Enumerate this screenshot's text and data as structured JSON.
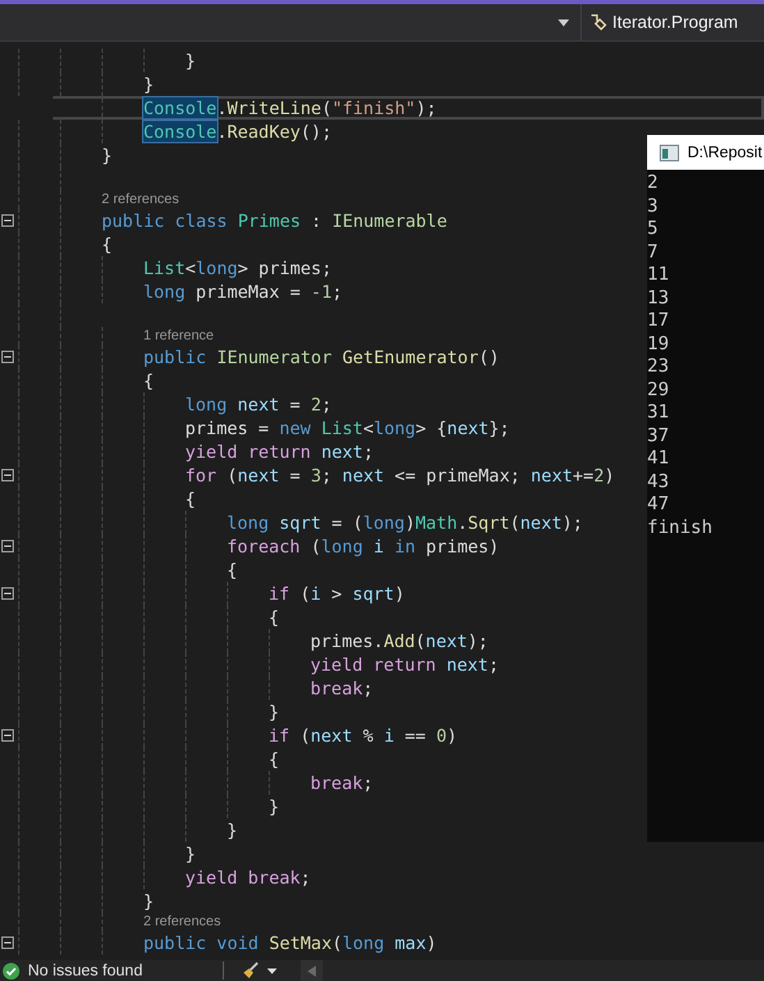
{
  "navigation_bar": {
    "member_dropdown": "Iterator.Program"
  },
  "lines": [
    {
      "kind": "group",
      "children": [
        {
          "kind": "group",
          "children": [
            {
              "kind": "code",
              "fold": false,
              "current": false,
              "tokens": [
                {
                  "text": "}",
                  "kind": "plain"
                }
              ]
            }
          ]
        },
        {
          "kind": "code",
          "fold": false,
          "current": false,
          "tokens": [
            {
              "text": "}",
              "kind": "plain"
            }
          ]
        },
        {
          "kind": "code",
          "fold": false,
          "current": true,
          "tokens": [
            {
              "text": "Console",
              "kind": "type",
              "highlighted": true
            },
            {
              "text": ".",
              "kind": "plain"
            },
            {
              "text": "WriteLine",
              "kind": "method"
            },
            {
              "text": "(",
              "kind": "plain"
            },
            {
              "text": "\"finish\"",
              "kind": "string"
            },
            {
              "text": ");",
              "kind": "plain"
            }
          ]
        },
        {
          "kind": "code",
          "fold": false,
          "current": false,
          "tokens": [
            {
              "text": "Console",
              "kind": "type",
              "highlighted": true
            },
            {
              "text": ".",
              "kind": "plain"
            },
            {
              "text": "ReadKey",
              "kind": "method"
            },
            {
              "text": "();",
              "kind": "plain"
            }
          ]
        }
      ]
    },
    {
      "kind": "code",
      "fold": false,
      "current": false,
      "tokens": [
        {
          "text": "}",
          "kind": "plain"
        }
      ]
    },
    {
      "kind": "blank"
    },
    {
      "kind": "codelens",
      "text": "2 references"
    },
    {
      "kind": "code",
      "fold": true,
      "current": false,
      "tokens": [
        {
          "text": "public class ",
          "kind": "keyword"
        },
        {
          "text": "Primes",
          "kind": "type"
        },
        {
          "text": " : ",
          "kind": "plain"
        },
        {
          "text": "IEnumerable",
          "kind": "interface"
        }
      ]
    },
    {
      "kind": "code",
      "fold": false,
      "current": false,
      "tokens": [
        {
          "text": "{",
          "kind": "plain"
        }
      ],
      "children": [
        {
          "kind": "code",
          "fold": false,
          "current": false,
          "tokens": [
            {
              "text": "List",
              "kind": "type"
            },
            {
              "text": "<",
              "kind": "plain"
            },
            {
              "text": "long",
              "kind": "keyword"
            },
            {
              "text": "> primes;",
              "kind": "plain"
            }
          ]
        },
        {
          "kind": "code",
          "fold": false,
          "current": false,
          "tokens": [
            {
              "text": "long",
              "kind": "keyword"
            },
            {
              "text": " primeMax = ",
              "kind": "plain"
            },
            {
              "text": "-1",
              "kind": "number"
            },
            {
              "text": ";",
              "kind": "plain"
            }
          ]
        },
        {
          "kind": "blank"
        },
        {
          "kind": "codelens",
          "text": "1 reference"
        },
        {
          "kind": "code",
          "fold": true,
          "current": false,
          "tokens": [
            {
              "text": "public ",
              "kind": "keyword"
            },
            {
              "text": "IEnumerator",
              "kind": "interface"
            },
            {
              "text": " GetEnumerator",
              "kind": "method"
            },
            {
              "text": "()",
              "kind": "plain"
            }
          ]
        },
        {
          "kind": "code",
          "fold": false,
          "current": false,
          "tokens": [
            {
              "text": "{",
              "kind": "plain"
            }
          ],
          "children": [
            {
              "kind": "code",
              "fold": false,
              "current": false,
              "tokens": [
                {
                  "text": "long ",
                  "kind": "keyword"
                },
                {
                  "text": "next",
                  "kind": "local"
                },
                {
                  "text": " = ",
                  "kind": "plain"
                },
                {
                  "text": "2",
                  "kind": "number"
                },
                {
                  "text": ";",
                  "kind": "plain"
                }
              ]
            },
            {
              "kind": "code",
              "fold": false,
              "current": false,
              "tokens": [
                {
                  "text": "primes = ",
                  "kind": "plain"
                },
                {
                  "text": "new ",
                  "kind": "keyword"
                },
                {
                  "text": "List",
                  "kind": "type"
                },
                {
                  "text": "<",
                  "kind": "plain"
                },
                {
                  "text": "long",
                  "kind": "keyword"
                },
                {
                  "text": "> {",
                  "kind": "plain"
                },
                {
                  "text": "next",
                  "kind": "local"
                },
                {
                  "text": "};",
                  "kind": "plain"
                }
              ]
            },
            {
              "kind": "code",
              "fold": false,
              "current": false,
              "tokens": [
                {
                  "text": "yield return ",
                  "kind": "control"
                },
                {
                  "text": "next",
                  "kind": "local"
                },
                {
                  "text": ";",
                  "kind": "plain"
                }
              ]
            },
            {
              "kind": "code",
              "fold": true,
              "current": false,
              "tokens": [
                {
                  "text": "for",
                  "kind": "control"
                },
                {
                  "text": " (",
                  "kind": "plain"
                },
                {
                  "text": "next",
                  "kind": "local"
                },
                {
                  "text": " = ",
                  "kind": "plain"
                },
                {
                  "text": "3",
                  "kind": "number"
                },
                {
                  "text": "; ",
                  "kind": "plain"
                },
                {
                  "text": "next",
                  "kind": "local"
                },
                {
                  "text": " <= primeMax; ",
                  "kind": "plain"
                },
                {
                  "text": "next",
                  "kind": "local"
                },
                {
                  "text": "+=",
                  "kind": "plain"
                },
                {
                  "text": "2",
                  "kind": "number"
                },
                {
                  "text": ")",
                  "kind": "plain"
                }
              ]
            },
            {
              "kind": "code",
              "fold": false,
              "current": false,
              "tokens": [
                {
                  "text": "{",
                  "kind": "plain"
                }
              ],
              "children": [
                {
                  "kind": "code",
                  "fold": false,
                  "current": false,
                  "tokens": [
                    {
                      "text": "long ",
                      "kind": "keyword"
                    },
                    {
                      "text": "sqrt",
                      "kind": "local"
                    },
                    {
                      "text": " = (",
                      "kind": "plain"
                    },
                    {
                      "text": "long",
                      "kind": "keyword"
                    },
                    {
                      "text": ")",
                      "kind": "plain"
                    },
                    {
                      "text": "Math",
                      "kind": "type"
                    },
                    {
                      "text": ".",
                      "kind": "plain"
                    },
                    {
                      "text": "Sqrt",
                      "kind": "method"
                    },
                    {
                      "text": "(",
                      "kind": "plain"
                    },
                    {
                      "text": "next",
                      "kind": "local"
                    },
                    {
                      "text": ");",
                      "kind": "plain"
                    }
                  ]
                },
                {
                  "kind": "code",
                  "fold": true,
                  "current": false,
                  "tokens": [
                    {
                      "text": "foreach",
                      "kind": "control"
                    },
                    {
                      "text": " (",
                      "kind": "plain"
                    },
                    {
                      "text": "long ",
                      "kind": "keyword"
                    },
                    {
                      "text": "i",
                      "kind": "local"
                    },
                    {
                      "text": " in ",
                      "kind": "keyword"
                    },
                    {
                      "text": "primes)",
                      "kind": "plain"
                    }
                  ]
                },
                {
                  "kind": "code",
                  "fold": false,
                  "current": false,
                  "tokens": [
                    {
                      "text": "{",
                      "kind": "plain"
                    }
                  ],
                  "children": [
                    {
                      "kind": "code",
                      "fold": true,
                      "current": false,
                      "tokens": [
                        {
                          "text": "if",
                          "kind": "control"
                        },
                        {
                          "text": " (",
                          "kind": "plain"
                        },
                        {
                          "text": "i",
                          "kind": "local"
                        },
                        {
                          "text": " > ",
                          "kind": "plain"
                        },
                        {
                          "text": "sqrt",
                          "kind": "local"
                        },
                        {
                          "text": ")",
                          "kind": "plain"
                        }
                      ]
                    },
                    {
                      "kind": "code",
                      "fold": false,
                      "current": false,
                      "tokens": [
                        {
                          "text": "{",
                          "kind": "plain"
                        }
                      ],
                      "children": [
                        {
                          "kind": "code",
                          "fold": false,
                          "current": false,
                          "tokens": [
                            {
                              "text": "primes.",
                              "kind": "plain"
                            },
                            {
                              "text": "Add",
                              "kind": "method"
                            },
                            {
                              "text": "(",
                              "kind": "plain"
                            },
                            {
                              "text": "next",
                              "kind": "local"
                            },
                            {
                              "text": ");",
                              "kind": "plain"
                            }
                          ]
                        },
                        {
                          "kind": "code",
                          "fold": false,
                          "current": false,
                          "tokens": [
                            {
                              "text": "yield return ",
                              "kind": "control"
                            },
                            {
                              "text": "next",
                              "kind": "local"
                            },
                            {
                              "text": ";",
                              "kind": "plain"
                            }
                          ]
                        },
                        {
                          "kind": "code",
                          "fold": false,
                          "current": false,
                          "tokens": [
                            {
                              "text": "break",
                              "kind": "control"
                            },
                            {
                              "text": ";",
                              "kind": "plain"
                            }
                          ]
                        }
                      ]
                    },
                    {
                      "kind": "code",
                      "fold": false,
                      "current": false,
                      "tokens": [
                        {
                          "text": "}",
                          "kind": "plain"
                        }
                      ]
                    },
                    {
                      "kind": "code",
                      "fold": true,
                      "current": false,
                      "tokens": [
                        {
                          "text": "if",
                          "kind": "control"
                        },
                        {
                          "text": " (",
                          "kind": "plain"
                        },
                        {
                          "text": "next",
                          "kind": "local"
                        },
                        {
                          "text": " % ",
                          "kind": "plain"
                        },
                        {
                          "text": "i",
                          "kind": "local"
                        },
                        {
                          "text": " == ",
                          "kind": "plain"
                        },
                        {
                          "text": "0",
                          "kind": "number"
                        },
                        {
                          "text": ")",
                          "kind": "plain"
                        }
                      ]
                    },
                    {
                      "kind": "code",
                      "fold": false,
                      "current": false,
                      "tokens": [
                        {
                          "text": "{",
                          "kind": "plain"
                        }
                      ],
                      "children": [
                        {
                          "kind": "code",
                          "fold": false,
                          "current": false,
                          "tokens": [
                            {
                              "text": "break",
                              "kind": "control"
                            },
                            {
                              "text": ";",
                              "kind": "plain"
                            }
                          ]
                        }
                      ]
                    },
                    {
                      "kind": "code",
                      "fold": false,
                      "current": false,
                      "tokens": [
                        {
                          "text": "}",
                          "kind": "plain"
                        }
                      ]
                    }
                  ]
                },
                {
                  "kind": "code",
                  "fold": false,
                  "current": false,
                  "tokens": [
                    {
                      "text": "}",
                      "kind": "plain"
                    }
                  ]
                }
              ]
            },
            {
              "kind": "code",
              "fold": false,
              "current": false,
              "tokens": [
                {
                  "text": "}",
                  "kind": "plain"
                }
              ]
            },
            {
              "kind": "code",
              "fold": false,
              "current": false,
              "tokens": [
                {
                  "text": "yield break",
                  "kind": "control"
                },
                {
                  "text": ";",
                  "kind": "plain"
                }
              ]
            }
          ]
        },
        {
          "kind": "code",
          "fold": false,
          "current": false,
          "tokens": [
            {
              "text": "}",
              "kind": "plain"
            }
          ]
        },
        {
          "kind": "codelens",
          "text": "2 references"
        },
        {
          "kind": "code",
          "fold": true,
          "current": false,
          "tokens": [
            {
              "text": "public void ",
              "kind": "keyword"
            },
            {
              "text": "SetMax",
              "kind": "method"
            },
            {
              "text": "(",
              "kind": "plain"
            },
            {
              "text": "long ",
              "kind": "keyword"
            },
            {
              "text": "max",
              "kind": "local"
            },
            {
              "text": ")",
              "kind": "plain"
            }
          ]
        }
      ]
    }
  ],
  "console_window": {
    "title": "D:\\Reposit",
    "output": [
      "2",
      "3",
      "5",
      "7",
      "11",
      "13",
      "17",
      "19",
      "23",
      "29",
      "31",
      "37",
      "41",
      "43",
      "47",
      "finish"
    ]
  },
  "status_bar": {
    "issues": "No issues found"
  }
}
